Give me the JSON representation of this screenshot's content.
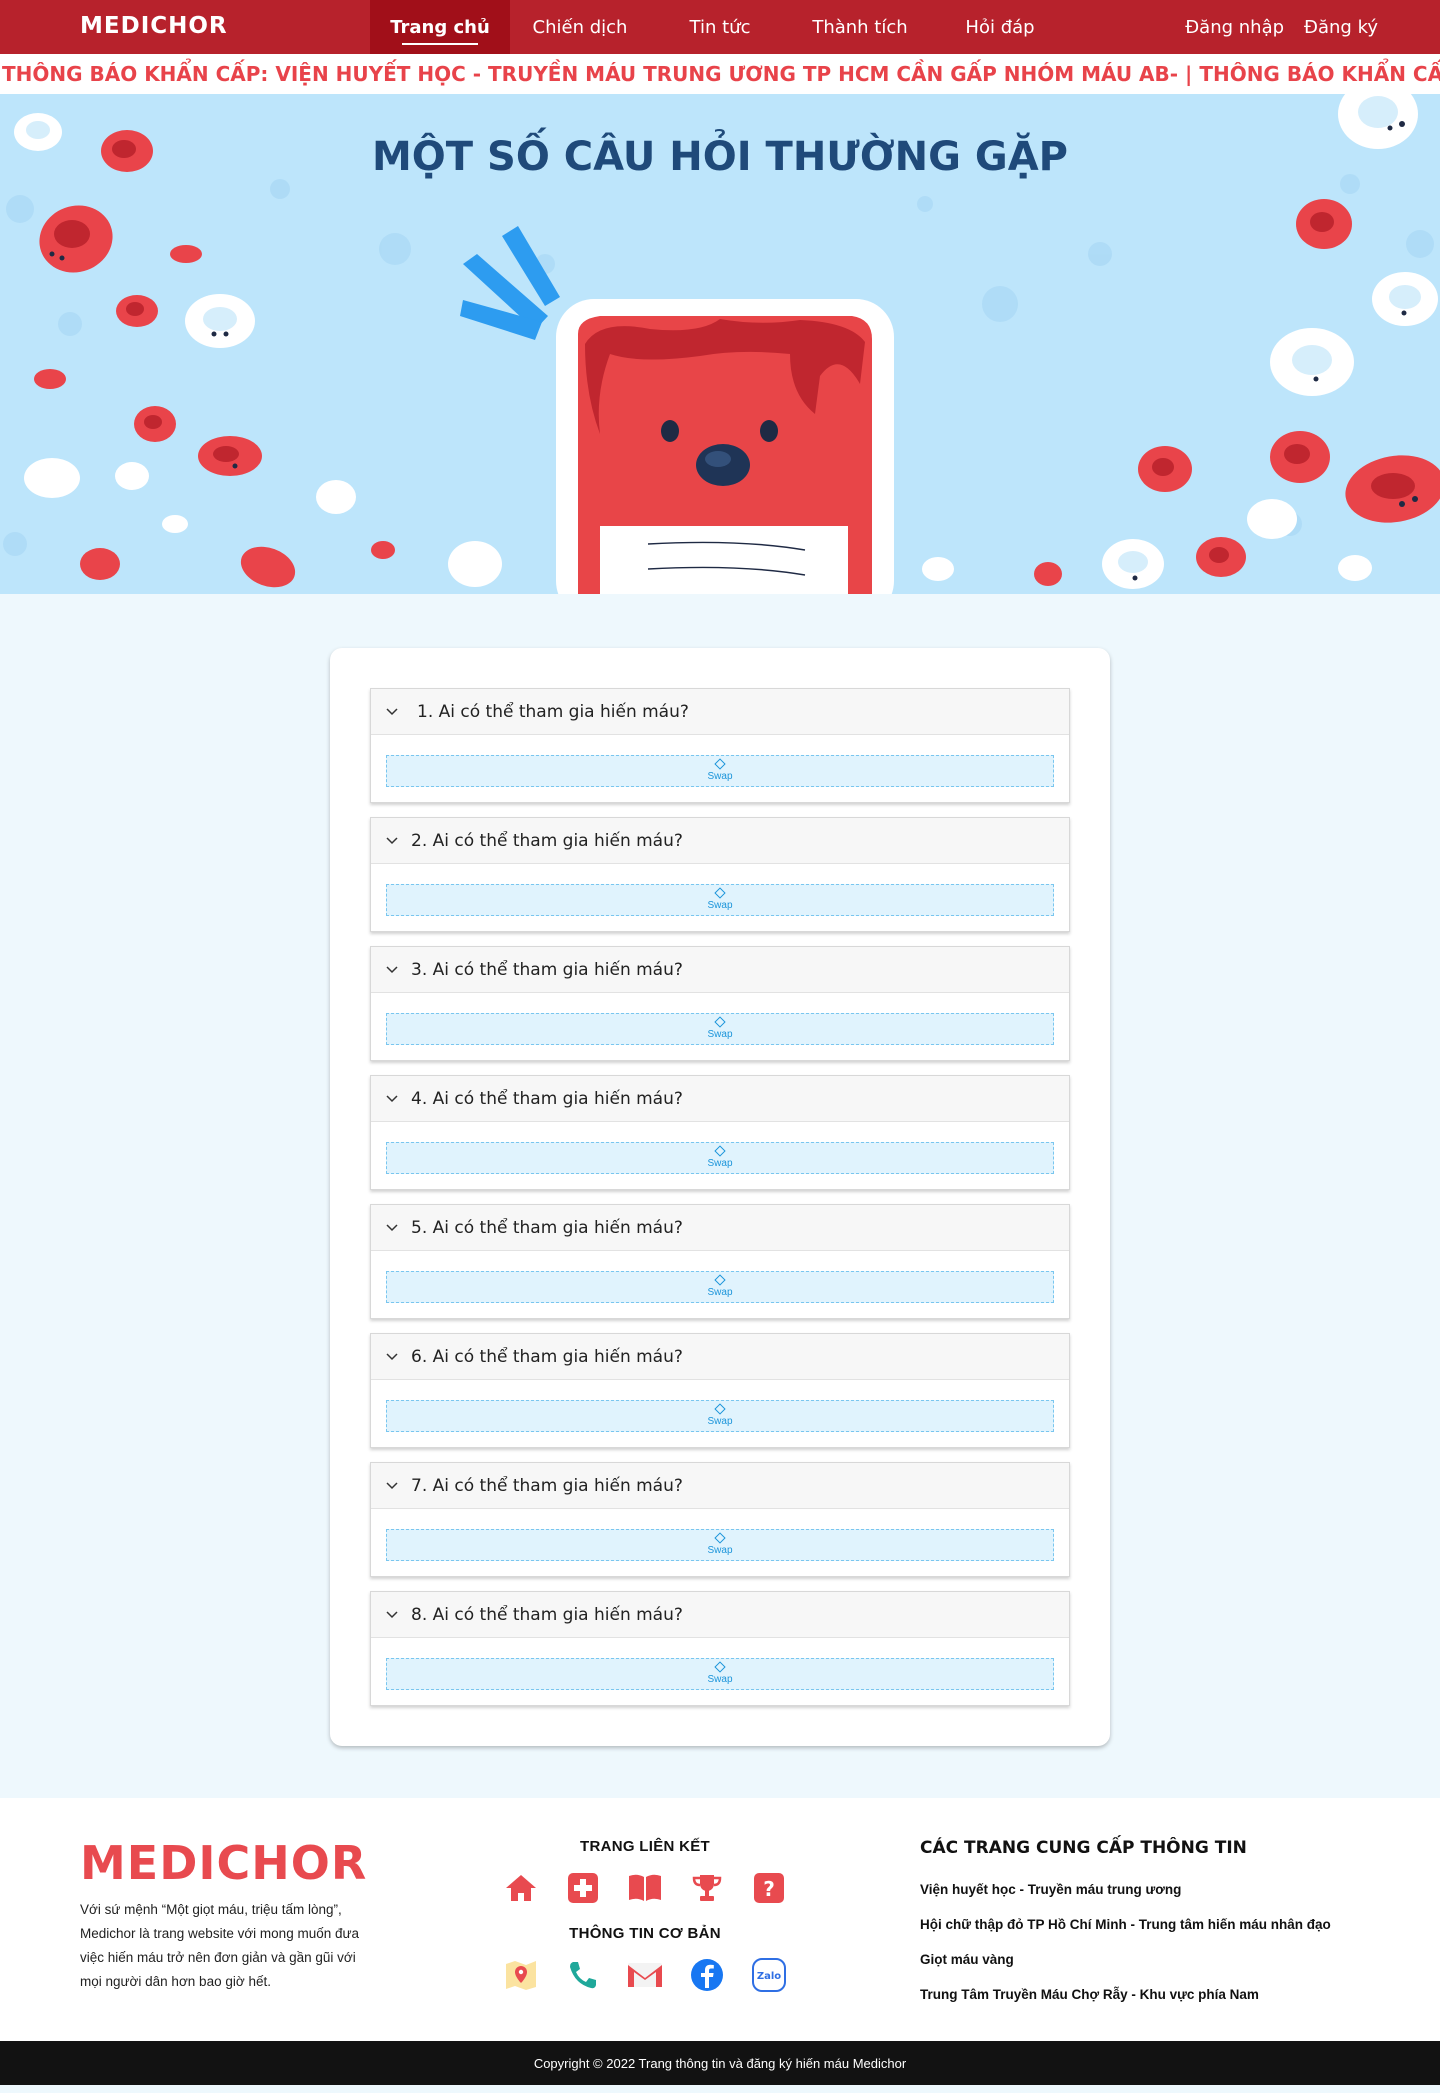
{
  "nav": {
    "logo": "MEDICHOR",
    "items": [
      {
        "label": "Trang chủ"
      },
      {
        "label": "Chiến dịch"
      },
      {
        "label": "Tin tức"
      },
      {
        "label": "Thành tích"
      },
      {
        "label": "Hỏi đáp"
      }
    ],
    "login": "Đăng nhập",
    "register": "Đăng ký"
  },
  "ticker": {
    "text": "THÔNG BÁO KHẨN CẤP: VIỆN HUYẾT HỌC - TRUYỀN MÁU TRUNG ƯƠNG TP HCM CẦN GẤP NHÓM MÁU AB-  |  THÔNG BÁO KHẨN CẤP: BỆNH VIỆN"
  },
  "hero": {
    "title": "MỘT SỐ CÂU HỎI THƯỜNG GẶP"
  },
  "faq": {
    "items": [
      {
        "question": "1. Ai có thể tham gia hiến máu?",
        "placeholder": "Swap"
      },
      {
        "question": "2. Ai có thể tham gia hiến máu?",
        "placeholder": "Swap"
      },
      {
        "question": "3. Ai có thể tham gia hiến máu?",
        "placeholder": "Swap"
      },
      {
        "question": "4. Ai có thể tham gia hiến máu?",
        "placeholder": "Swap"
      },
      {
        "question": "5. Ai có thể tham gia hiến máu?",
        "placeholder": "Swap"
      },
      {
        "question": "6. Ai có thể tham gia hiến máu?",
        "placeholder": "Swap"
      },
      {
        "question": "7. Ai có thể tham gia hiến máu?",
        "placeholder": "Swap"
      },
      {
        "question": "8. Ai có thể tham gia hiến máu?",
        "placeholder": "Swap"
      }
    ]
  },
  "footer": {
    "logo": "MEDICHOR",
    "mission": "Với sứ mệnh “Một giọt máu, triệu tấm lòng”, Medichor là trang website với mong muốn đưa việc hiến máu trở nên đơn giản và gần gũi với mọi người dân hơn bao giờ hết.",
    "links_heading": "TRANG LIÊN KẾT",
    "info_heading": "THÔNG TIN CƠ BẢN",
    "link_icons": [
      "home-icon",
      "medical-cross-icon",
      "book-icon",
      "trophy-icon",
      "question-icon"
    ],
    "info_icons": [
      "map-icon",
      "phone-icon",
      "gmail-icon",
      "facebook-icon",
      "zalo-icon"
    ],
    "zalo_label": "Zalo",
    "providers_heading": "CÁC TRANG CUNG CẤP THÔNG TIN",
    "providers": [
      "Viện huyết học - Truyền máu trung ương",
      "Hội chữ thập đỏ TP Hồ Chí Minh - Trung tâm hiến máu nhân đạo",
      "Giọt máu vàng",
      "Trung Tâm Truyền Máu Chợ Rẫy - Khu vực phía Nam"
    ],
    "copyright": "Copyright © 2022 Trang thông tin và đăng ký hiến máu Medichor"
  },
  "colors": {
    "nav_bg": "#b7222c",
    "nav_active": "#a10f19",
    "ticker_text": "#e8434a",
    "hero_bg": "#bde5fb",
    "hero_title": "#1f4a7a",
    "accent_red": "#e84a4f",
    "footer_bar": "#121212"
  }
}
